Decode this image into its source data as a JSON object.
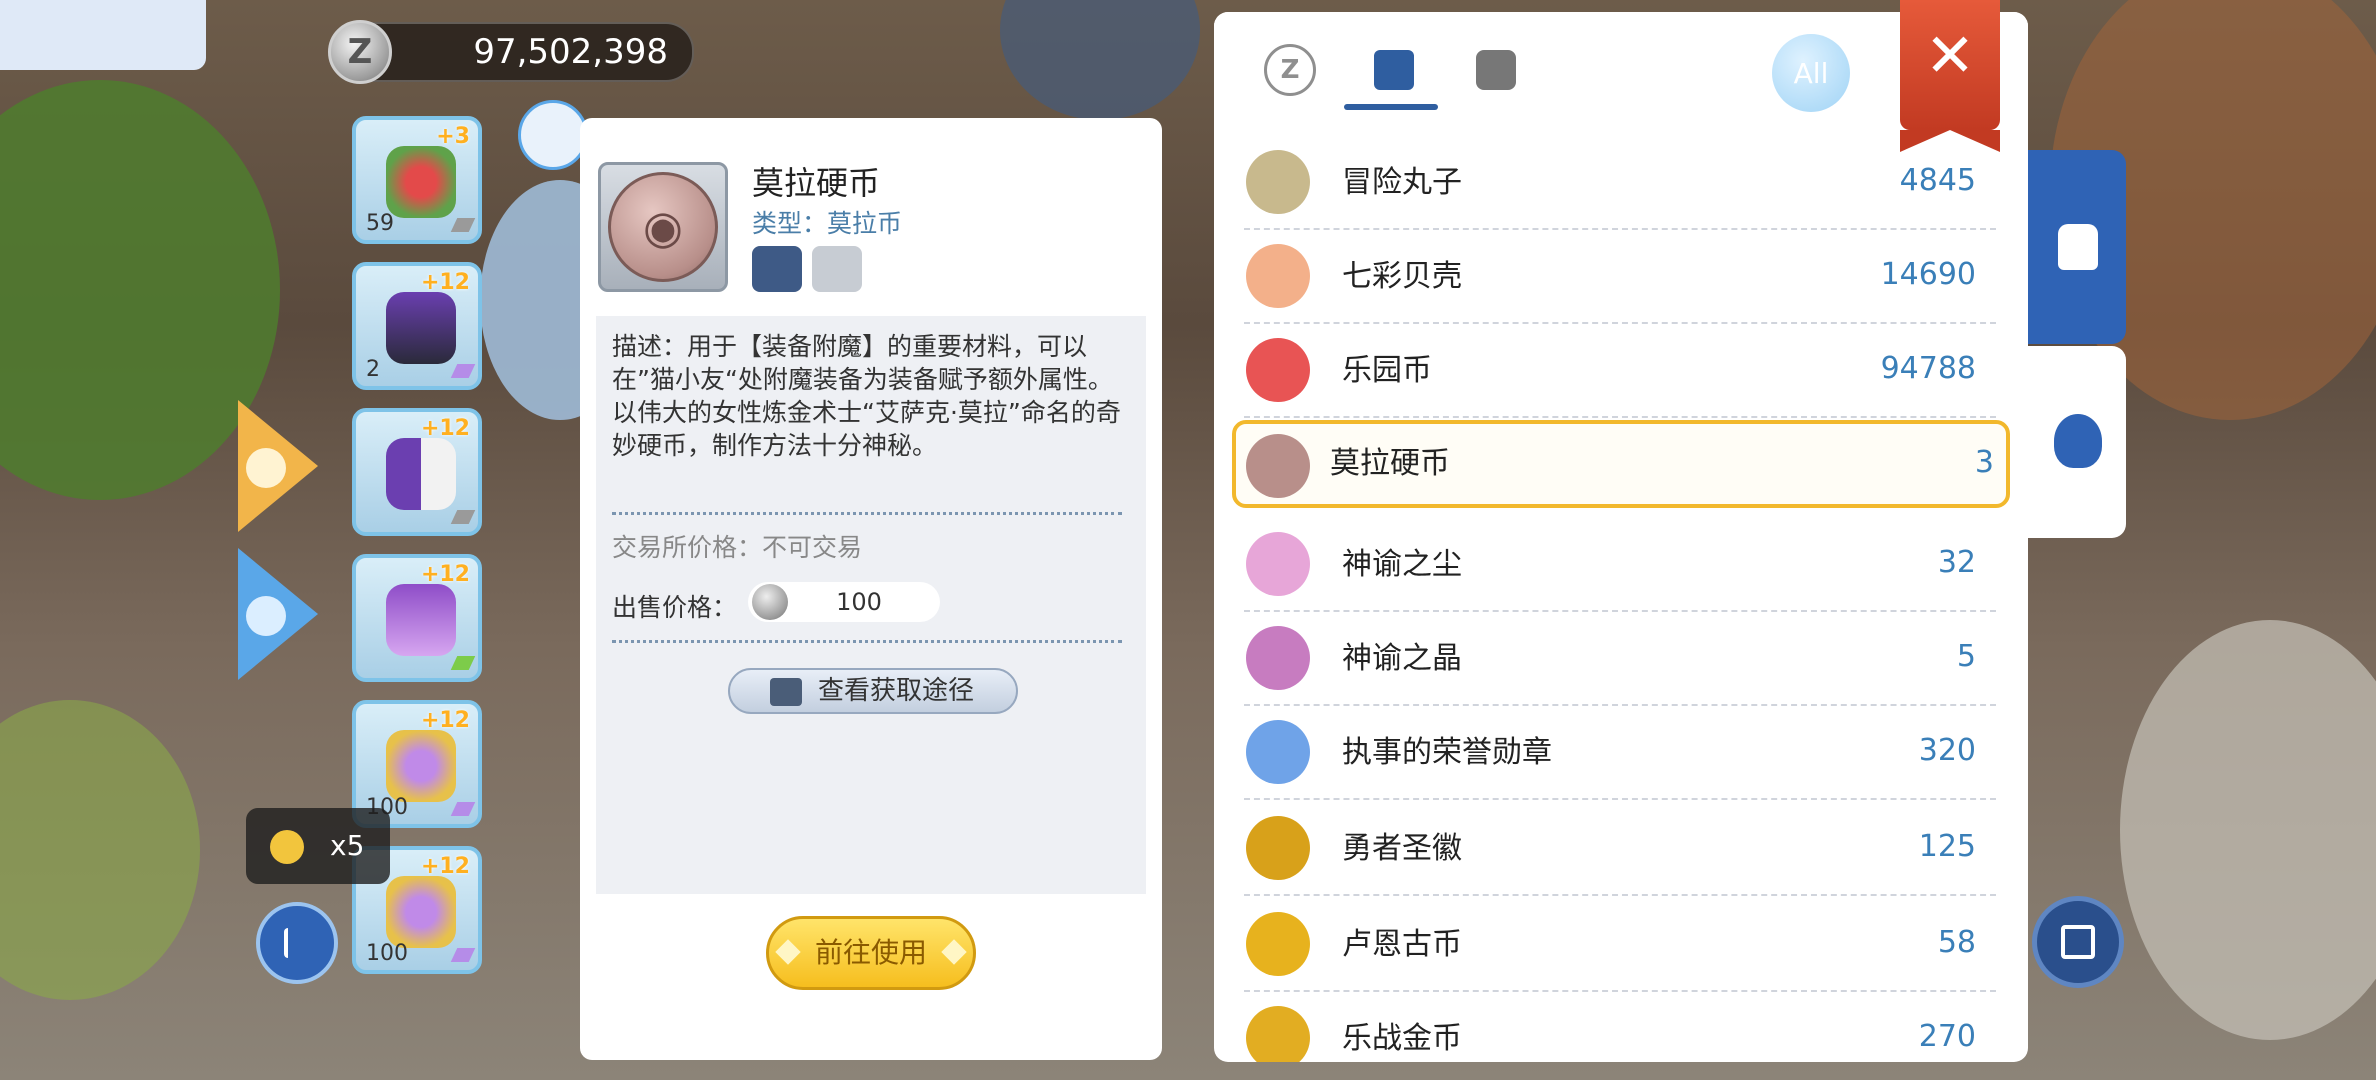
{
  "currency": {
    "icon": "zeny-coin-icon",
    "glyph": "Z",
    "value": "97,502,398"
  },
  "left_items": [
    {
      "name": "rose-wreath-icon",
      "level": "+3",
      "qty": "59"
    },
    {
      "name": "armor-icon",
      "level": "+12",
      "qty": "2"
    },
    {
      "name": "robe-icon",
      "level": "+12",
      "qty": ""
    },
    {
      "name": "boots-icon",
      "level": "+12",
      "qty": ""
    },
    {
      "name": "necklace-icon",
      "level": "+12",
      "qty": "100"
    },
    {
      "name": "necklace-icon",
      "level": "+12",
      "qty": "100"
    }
  ],
  "reward_badge": {
    "label": "x5"
  },
  "detail": {
    "name": "莫拉硬币",
    "type": "类型：莫拉币",
    "description": "描述：用于【装备附魔】的重要材料，可以在”猫小友“处附魔装备为装备赋予额外属性。\n以伟大的女性炼金术士“艾萨克·莫拉”命名的奇妙硬币，制作方法十分神秘。",
    "trade": "交易所价格：不可交易",
    "sell_label": "出售价格：",
    "sell_value": "100",
    "route_button": "查看获取途径",
    "use_button": "前往使用"
  },
  "inventory": {
    "all_label": "All",
    "close_glyph": "✕",
    "tab_z_glyph": "Z",
    "items": [
      {
        "name": "冒险丸子",
        "count": "4845",
        "icon": "dumpling-icon",
        "color": "#c8b98d"
      },
      {
        "name": "七彩贝壳",
        "count": "14690",
        "icon": "shell-icon",
        "color": "#f3b08a"
      },
      {
        "name": "乐园币",
        "count": "94788",
        "icon": "park-coin-icon",
        "color": "#e85454"
      },
      {
        "name": "莫拉硬币",
        "count": "3",
        "icon": "mora-coin-icon",
        "color": "#b88f8a",
        "selected": true
      },
      {
        "name": "神谕之尘",
        "count": "32",
        "icon": "oracle-dust-icon",
        "color": "#e7a6d8"
      },
      {
        "name": "神谕之晶",
        "count": "5",
        "icon": "oracle-crystal-icon",
        "color": "#c77cc0"
      },
      {
        "name": "执事的荣誉勋章",
        "count": "320",
        "icon": "honor-medal-icon",
        "color": "#6fa3e8"
      },
      {
        "name": "勇者圣徽",
        "count": "125",
        "icon": "hero-emblem-icon",
        "color": "#d8a11a"
      },
      {
        "name": "卢恩古币",
        "count": "58",
        "icon": "rune-coin-icon",
        "color": "#e7b21e"
      },
      {
        "name": "乐战金币",
        "count": "270",
        "icon": "battle-coin-icon",
        "color": "#e2ad22"
      }
    ]
  },
  "colors": {
    "accent": "#2f5ea0",
    "count": "#3a7fb8",
    "selected_border": "#f2b82c",
    "use_button": "#f6be1e"
  }
}
